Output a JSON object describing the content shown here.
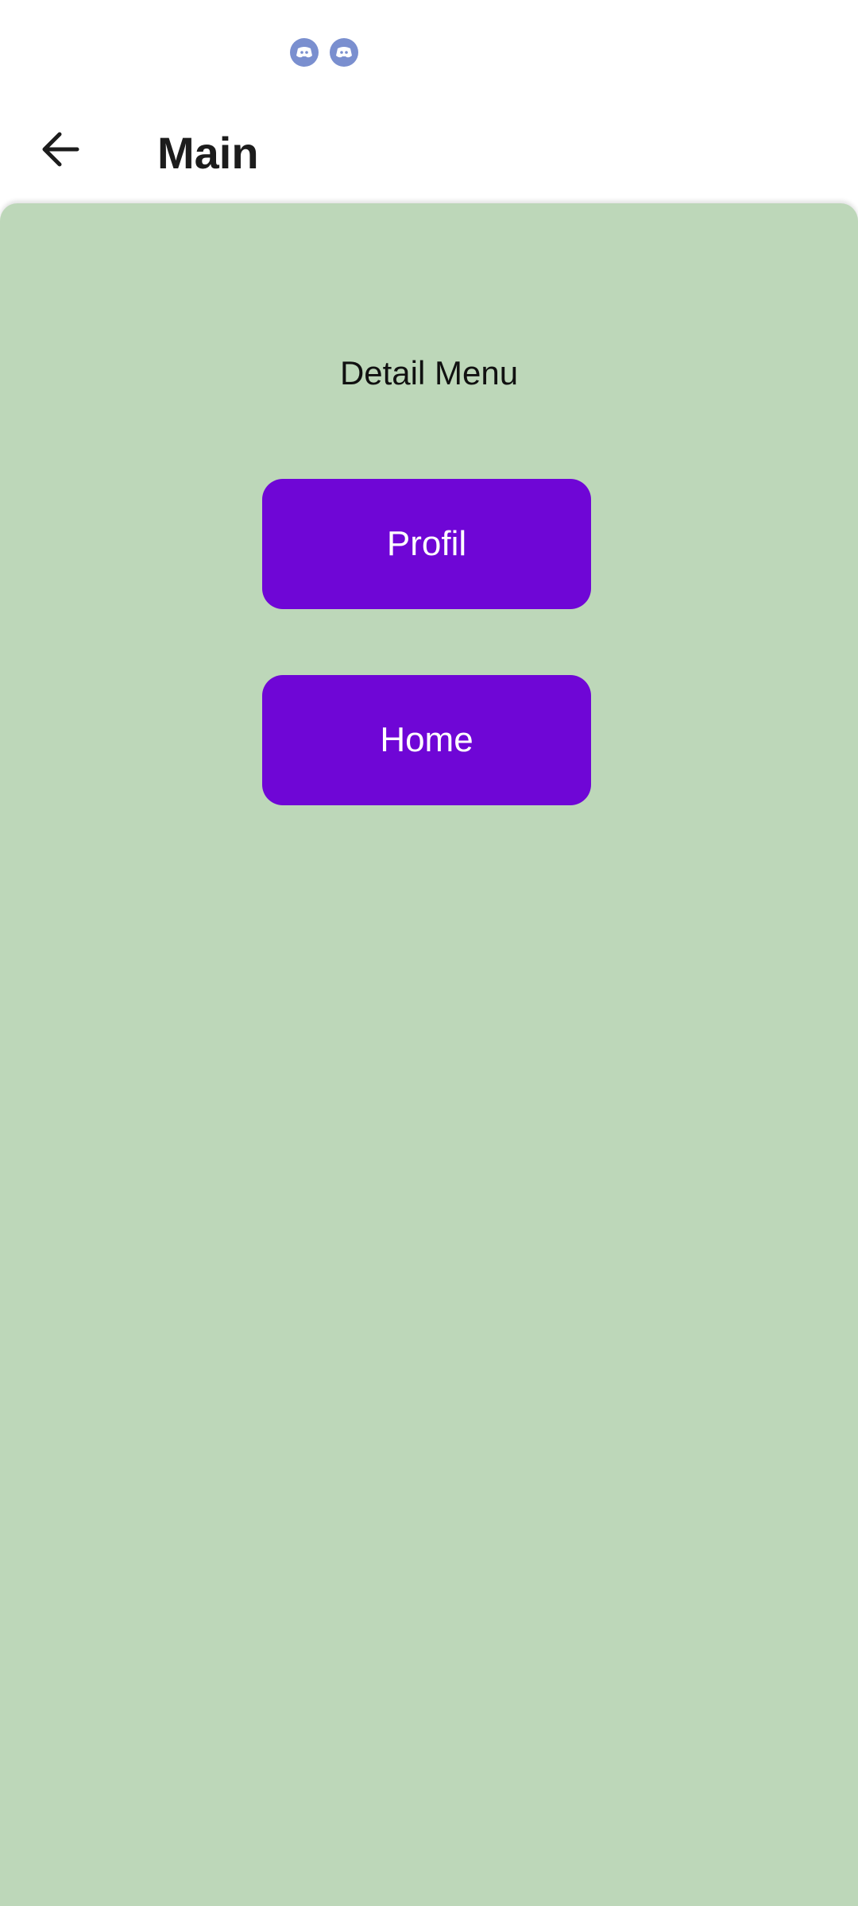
{
  "status_bar": {
    "icons": [
      "discord-icon",
      "discord-icon"
    ],
    "icon_color": "#7a8fcf"
  },
  "app_bar": {
    "title": "Main",
    "back_icon": "arrow-back-icon"
  },
  "content": {
    "background_color": "#bdd7b9",
    "heading": "Detail Menu",
    "buttons": [
      {
        "label": "Profil"
      },
      {
        "label": "Home"
      }
    ],
    "button_color": "#6f06d6"
  }
}
